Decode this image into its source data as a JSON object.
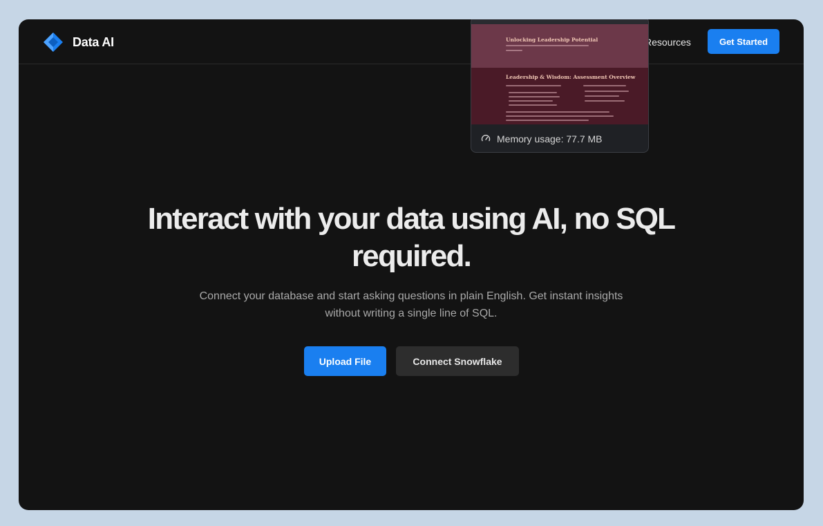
{
  "brand": {
    "name": "Data AI",
    "accent_color": "#1a7ff0"
  },
  "nav": {
    "links": [
      {
        "label": "Resources"
      }
    ],
    "cta_label": "Get Started"
  },
  "hero": {
    "title": "Interact with your data using AI, no SQL required.",
    "subtitle": "Connect your database and start asking questions in plain English. Get instant insights without writing a single line of SQL.",
    "primary_button": "Upload File",
    "secondary_button": "Connect Snowflake"
  },
  "tab_preview": {
    "page_heading": "Unlocking Leadership Potential",
    "section_heading": "Leadership & Wisdom: Assessment Overview",
    "memory_label": "Memory usage: 77.7 MB"
  }
}
